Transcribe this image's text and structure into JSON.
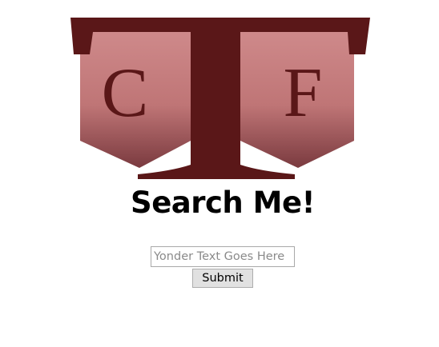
{
  "logo": {
    "letters": [
      "C",
      "T",
      "F"
    ],
    "colors": {
      "dark": "#5a1718",
      "light": "#cf8a8b",
      "shadow": "#7a3a3f"
    }
  },
  "heading": {
    "title": "Search Me!"
  },
  "search": {
    "placeholder": "Yonder Text Goes Here",
    "value": "",
    "submit_label": "Submit"
  }
}
